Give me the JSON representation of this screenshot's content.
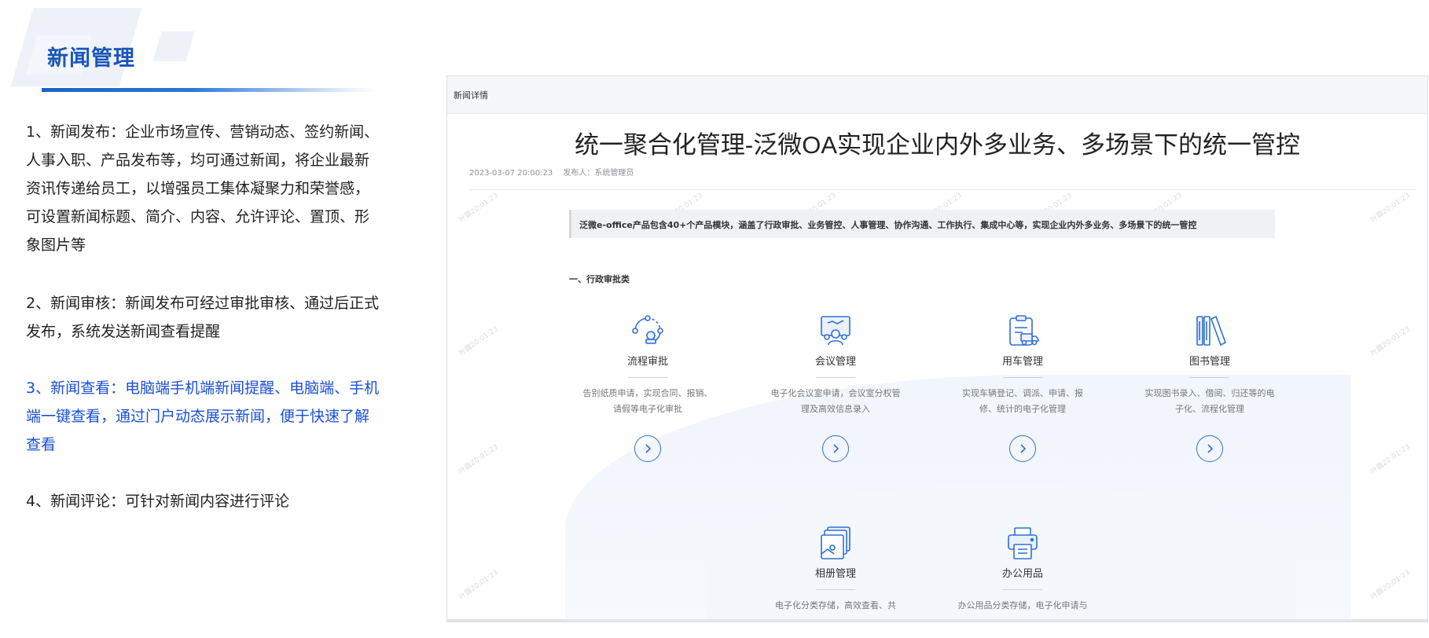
{
  "header": {
    "title": "新闻管理"
  },
  "features": [
    {
      "text": "1、新闻发布：企业市场宣传、营销动态、签约新闻、人事入职、产品发布等，均可通过新闻，将企业最新资讯传递给员工，以增强员工集体凝聚力和荣誉感，可设置新闻标题、简介、内容、允许评论、置顶、形象图片等",
      "highlight": false
    },
    {
      "text": "2、新闻审核：新闻发布可经过审批审核、通过后正式发布，系统发送新闻查看提醒",
      "highlight": false
    },
    {
      "text": "3、新闻查看：电脑端手机端新闻提醒、电脑端、手机端一键查看，通过门户动态展示新闻，便于快速了解查看",
      "highlight": true,
      "color": "#1b4fd6"
    },
    {
      "text": "4、新闻评论：可针对新闻内容进行评论",
      "highlight": false
    }
  ],
  "screenshot": {
    "bar_label": "新闻详情",
    "news_title": "统一聚合化管理-泛微OA实现企业内外多业务、多场景下的统一管控",
    "date": "2023-03-07 20:00:23",
    "publisher": "发布人：系统管理员",
    "summary": "泛微e-office产品包含40+个产品模块，涵盖了行政审批、业务管控、人事管理、协作沟通、工作执行、集成中心等，实现企业内外多业务、多场景下的统一管控",
    "section_heading": "一、行政审批类",
    "watermark": "叶露20:01:23",
    "modules": [
      {
        "name": "流程审批",
        "icon": "workflow-icon",
        "desc": "告别纸质申请，实现合同、报销、请假等电子化审批"
      },
      {
        "name": "会议管理",
        "icon": "meeting-icon",
        "desc": "电子化会议室申请，会议室分权管理及高效信息录入"
      },
      {
        "name": "用车管理",
        "icon": "vehicle-icon",
        "desc": "实现车辆登记、调派、申请、报修、统计的电子化管理"
      },
      {
        "name": "图书管理",
        "icon": "books-icon",
        "desc": "实现图书录入、借阅、归还等的电子化、流程化管理"
      },
      {
        "name": "相册管理",
        "icon": "album-icon",
        "desc": "电子化分类存储，高效查看、共"
      },
      {
        "name": "办公用品",
        "icon": "printer-icon",
        "desc": "办公用品分类存储，电子化申请与"
      }
    ]
  },
  "colors": {
    "brand_blue": "#1a56b8",
    "icon_blue": "#2f6fd4",
    "highlight_text": "#1b4fd6"
  }
}
